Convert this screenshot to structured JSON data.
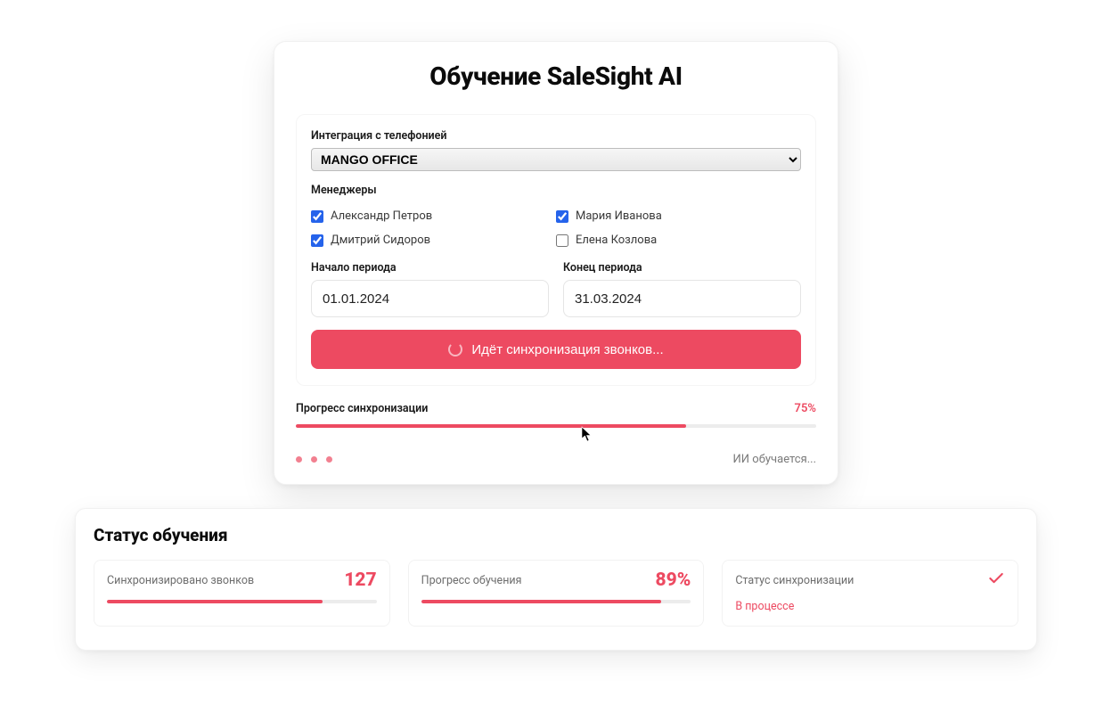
{
  "main": {
    "title": "Обучение SaleSight AI",
    "integration": {
      "label": "Интеграция с телефонией",
      "value": "MANGO OFFICE"
    },
    "managers": {
      "label": "Менеджеры",
      "items": [
        {
          "name": "Александр Петров",
          "checked": true
        },
        {
          "name": "Мария Иванова",
          "checked": true
        },
        {
          "name": "Дмитрий Сидоров",
          "checked": true
        },
        {
          "name": "Елена Козлова",
          "checked": false
        }
      ]
    },
    "dates": {
      "start_label": "Начало периода",
      "start_value": "01.01.2024",
      "end_label": "Конец периода",
      "end_value": "31.03.2024"
    },
    "button_label": "Идёт синхронизация звонков...",
    "progress": {
      "label": "Прогресс синхронизации",
      "pct_text": "75%",
      "pct": 75
    },
    "footer_status": "ИИ обучается..."
  },
  "status": {
    "title": "Статус обучения",
    "calls": {
      "label": "Синхронизировано звонков",
      "value": "127",
      "bar_pct": 80
    },
    "progress": {
      "label": "Прогресс обучения",
      "value": "89%",
      "bar_pct": 89
    },
    "sync_status": {
      "label": "Статус синхронизации",
      "value": "В процессе"
    }
  },
  "colors": {
    "accent": "#ed4a61"
  }
}
